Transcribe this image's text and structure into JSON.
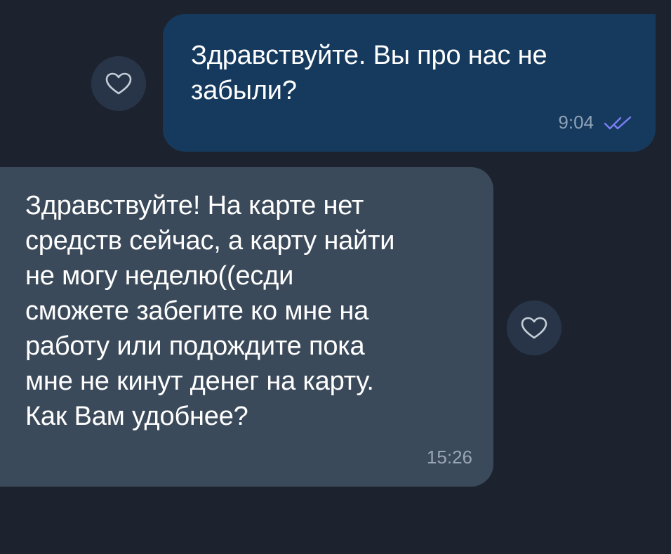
{
  "messages": [
    {
      "direction": "outgoing",
      "text": "Здравствуйте. Вы про нас не\nзабыли?",
      "time": "9:04",
      "status_icon": "double-check-icon"
    },
    {
      "direction": "incoming",
      "text": "Здравствуйте! На карте нет\nсредств сейчас, а карту найти\nне могу неделю((есди\nсможете забегите ко мне на\nработу или подождите пока\nмне не кинут денег на карту.\nКак Вам удобнее?",
      "time": "15:26"
    }
  ],
  "reactions": [
    {
      "icon": "heart-icon"
    },
    {
      "icon": "heart-icon"
    }
  ],
  "colors": {
    "background": "#1c232e",
    "outgoing_bubble": "#163a5e",
    "incoming_bubble": "#3b4a5a",
    "reaction_button": "#283548",
    "read_check": "#7b7ef5"
  }
}
